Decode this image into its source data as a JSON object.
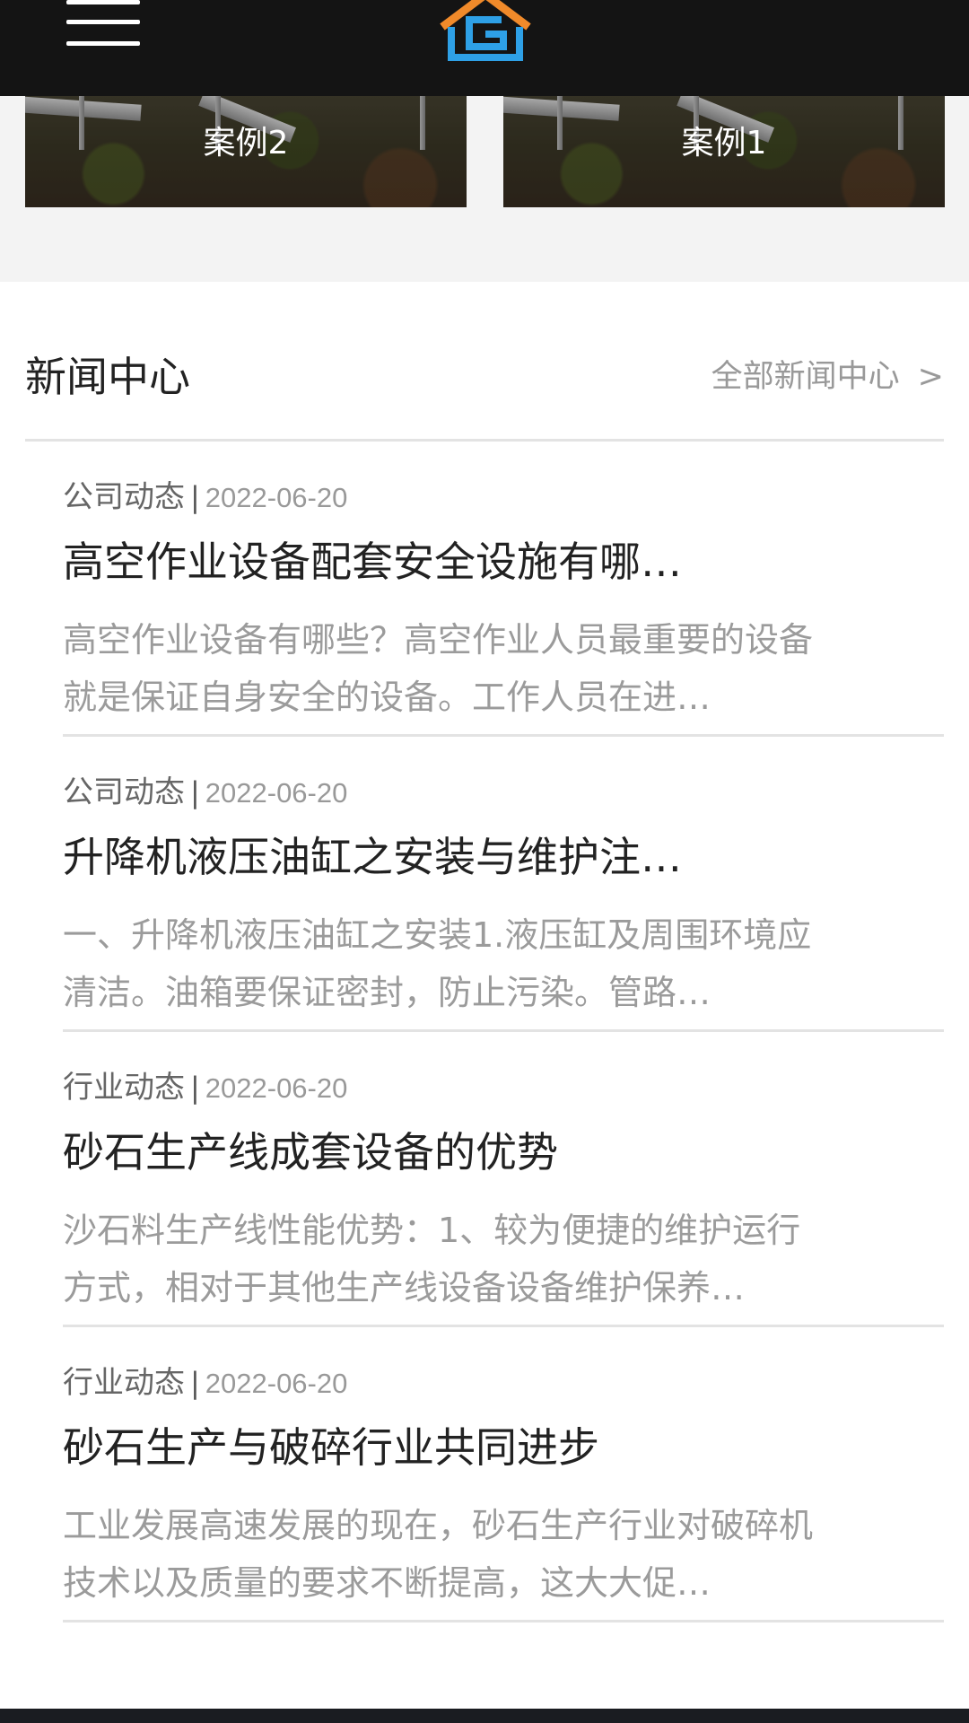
{
  "header": {
    "menu_icon": "hamburger-menu-icon",
    "logo_icon": "company-logo-house-g",
    "colors": {
      "background": "#141414",
      "logo_orange": "#f08a2a",
      "logo_blue": "#2ea0e6"
    }
  },
  "cases": [
    {
      "label": "案例2"
    },
    {
      "label": "案例1"
    }
  ],
  "news": {
    "title": "新闻中心",
    "more_label": "全部新闻中心",
    "more_arrow": ">",
    "separator": "|",
    "items": [
      {
        "category": "公司动态",
        "date": "2022-06-20",
        "headline": "高空作业设备配套安全设施有哪…",
        "summary_line1": "高空作业设备有哪些？高空作业人员最重要的设备",
        "summary_line2": "就是保证自身安全的设备。工作人员在进…"
      },
      {
        "category": "公司动态",
        "date": "2022-06-20",
        "headline": "升降机液压油缸之安装与维护注…",
        "summary_line1": "一、升降机液压油缸之安装1.液压缸及周围环境应",
        "summary_line2": "清洁。油箱要保证密封，防止污染。管路…"
      },
      {
        "category": "行业动态",
        "date": "2022-06-20",
        "headline": "砂石生产线成套设备的优势",
        "summary_line1": "沙石料生产线性能优势：1、较为便捷的维护运行",
        "summary_line2": "方式，相对于其他生产线设备设备维护保养…"
      },
      {
        "category": "行业动态",
        "date": "2022-06-20",
        "headline": "砂石生产与破碎行业共同进步",
        "summary_line1": "工业发展高速发展的现在，砂石生产行业对破碎机",
        "summary_line2": "技术以及质量的要求不断提高，这大大促…"
      }
    ]
  }
}
